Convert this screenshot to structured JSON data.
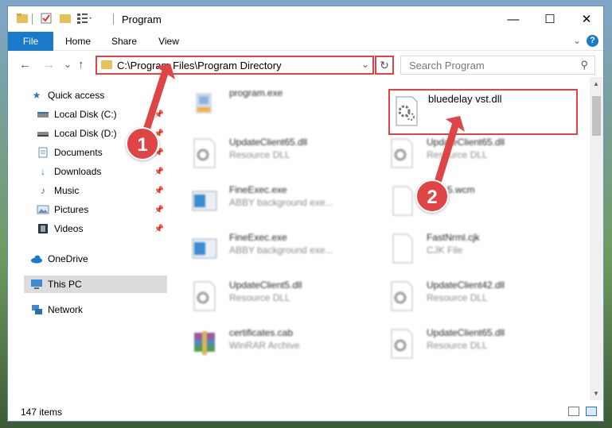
{
  "window": {
    "title": "Program",
    "controls": {
      "minimize": "—",
      "maximize": "☐",
      "close": "✕"
    }
  },
  "ribbon": {
    "tabs": [
      {
        "label": "File"
      },
      {
        "label": "Home"
      },
      {
        "label": "Share"
      },
      {
        "label": "View"
      }
    ],
    "help": "?"
  },
  "navbar": {
    "back": "←",
    "forward": "→",
    "recent": "⌄",
    "up": "↑",
    "path": "C:\\Program Files\\Program Directory",
    "refresh": "↻",
    "search_placeholder": "Search Program"
  },
  "sidebar": {
    "items": [
      {
        "label": "Quick access",
        "icon": "star-icon",
        "pinned": false
      },
      {
        "label": "Local Disk (C:)",
        "icon": "drive-icon",
        "pinned": true
      },
      {
        "label": "Local Disk (D:)",
        "icon": "drive-icon",
        "pinned": true
      },
      {
        "label": "Documents",
        "icon": "documents-icon",
        "pinned": true
      },
      {
        "label": "Downloads",
        "icon": "download-icon",
        "pinned": true
      },
      {
        "label": "Music",
        "icon": "music-icon",
        "pinned": true
      },
      {
        "label": "Pictures",
        "icon": "pictures-icon",
        "pinned": true
      },
      {
        "label": "Videos",
        "icon": "videos-icon",
        "pinned": true
      },
      {
        "label": "OneDrive",
        "icon": "cloud-icon",
        "pinned": false
      },
      {
        "label": "This PC",
        "icon": "computer-icon",
        "pinned": false,
        "selected": true
      },
      {
        "label": "Network",
        "icon": "network-icon",
        "pinned": false
      }
    ]
  },
  "files": [
    {
      "name": "program.exe",
      "type": "",
      "icon": "installer-icon"
    },
    {
      "name": "bluedelay vst.dll",
      "type": "",
      "icon": "dll-gear-icon",
      "highlighted": true
    },
    {
      "name": "UpdateClient65.dll",
      "type": "Resource DLL",
      "icon": "dll-gear-icon"
    },
    {
      "name": "UpdateClient65.dll",
      "type": "Resource DLL",
      "icon": "dll-gear-icon"
    },
    {
      "name": "FineExec.exe",
      "type": "ABBY background exe...",
      "icon": "app-window-icon"
    },
    {
      "name": "WP15.wcm",
      "type": "File",
      "icon": "blank-file-icon"
    },
    {
      "name": "FineExec.exe",
      "type": "ABBY background exe...",
      "icon": "app-window-icon"
    },
    {
      "name": "FastNrml.cjk",
      "type": "CJK File",
      "icon": "blank-file-icon"
    },
    {
      "name": "UpdateClient5.dll",
      "type": "Resource DLL",
      "icon": "dll-gear-icon"
    },
    {
      "name": "UpdateClient42.dll",
      "type": "Resource DLL",
      "icon": "dll-gear-icon"
    },
    {
      "name": "certificates.cab",
      "type": "WinRAR Archive",
      "icon": "archive-icon"
    },
    {
      "name": "UpdateClient65.dll",
      "type": "Resource DLL",
      "icon": "dll-gear-icon"
    }
  ],
  "status": {
    "items_count": "147 items"
  },
  "callouts": [
    {
      "label": "1"
    },
    {
      "label": "2"
    }
  ],
  "colors": {
    "accent": "#1979ca",
    "highlight": "#e04545",
    "folder": "#e6c15a"
  }
}
